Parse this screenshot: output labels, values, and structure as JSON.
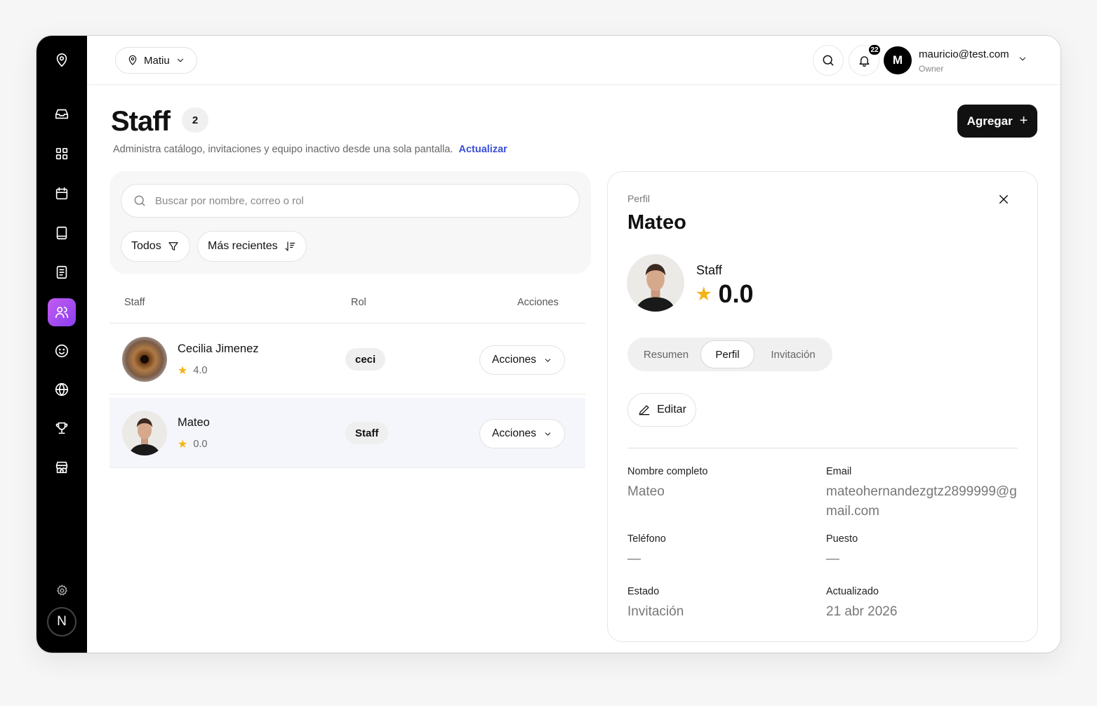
{
  "topbar": {
    "location": "Matiu",
    "notification_count": "22",
    "user_initial": "M",
    "user_email": "mauricio@test.com",
    "user_role": "Owner"
  },
  "sidebar": {
    "items": [
      "location-pin-icon",
      "inbox-icon",
      "grid-icon",
      "calendar-icon",
      "book-icon",
      "document-icon",
      "users-icon",
      "smile-icon",
      "globe-icon",
      "trophy-icon",
      "store-icon",
      "settings-icon"
    ],
    "active": "users-icon",
    "avatar_initial": "N"
  },
  "page": {
    "title": "Staff",
    "count": "2",
    "subtitle": "Administra catálogo, invitaciones y equipo inactivo desde una sola pantalla.",
    "refresh_link": "Actualizar",
    "add_button": "Agregar"
  },
  "filters": {
    "search_placeholder": "Buscar por nombre, correo o rol",
    "status_filter": "Todos",
    "sort_filter": "Más recientes"
  },
  "table": {
    "columns": [
      "Staff",
      "Rol",
      "Acciones"
    ],
    "rows": [
      {
        "name": "Cecilia Jimenez",
        "rating": "4.0",
        "role": "ceci",
        "actions": "Acciones"
      },
      {
        "name": "Mateo",
        "rating": "0.0",
        "role": "Staff",
        "actions": "Acciones"
      }
    ]
  },
  "panel": {
    "label": "Perfil",
    "name": "Mateo",
    "role": "Staff",
    "rating": "0.0",
    "tabs": [
      "Resumen",
      "Perfil",
      "Invitación"
    ],
    "active_tab": "Perfil",
    "edit_button": "Editar",
    "fields": {
      "full_name_label": "Nombre completo",
      "full_name_value": "Mateo",
      "email_label": "Email",
      "email_value_line1": "mateohernandezgtz2899999@g",
      "email_value_line2": "mail.com",
      "phone_label": "Teléfono",
      "phone_value": "—",
      "position_label": "Puesto",
      "position_value": "—",
      "status_label": "Estado",
      "status_value": "Invitación",
      "updated_label": "Actualizado",
      "updated_value": "21 abr 2026"
    }
  },
  "colors": {
    "accent_link": "#3b4fd8",
    "active_nav_gradient_start": "#c35cf2",
    "active_nav_gradient_end": "#8b3ff0",
    "star": "#f5b316"
  }
}
